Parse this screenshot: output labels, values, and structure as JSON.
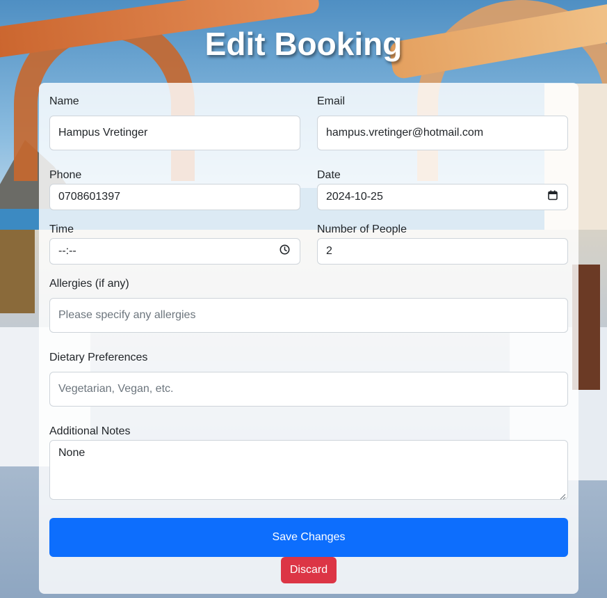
{
  "page": {
    "title": "Edit Booking"
  },
  "form": {
    "name": {
      "label": "Name",
      "value": "Hampus Vretinger"
    },
    "email": {
      "label": "Email",
      "value": "hampus.vretinger@hotmail.com"
    },
    "phone": {
      "label": "Phone",
      "value": "0708601397"
    },
    "date": {
      "label": "Date",
      "value": "2024-10-25",
      "icon": "calendar-icon"
    },
    "time": {
      "label": "Time",
      "value": "--:--",
      "icon": "clock-icon"
    },
    "people": {
      "label": "Number of People",
      "value": "2"
    },
    "allergies": {
      "label": "Allergies (if any)",
      "placeholder": "Please specify any allergies"
    },
    "dietary": {
      "label": "Dietary Preferences",
      "placeholder": "Vegetarian, Vegan, etc."
    },
    "notes": {
      "label": "Additional Notes",
      "value": "None"
    }
  },
  "actions": {
    "save_label": "Save Changes",
    "discard_label": "Discard"
  },
  "colors": {
    "primary": "#0d6efd",
    "danger": "#dc3545",
    "title_text": "#ffffff"
  }
}
